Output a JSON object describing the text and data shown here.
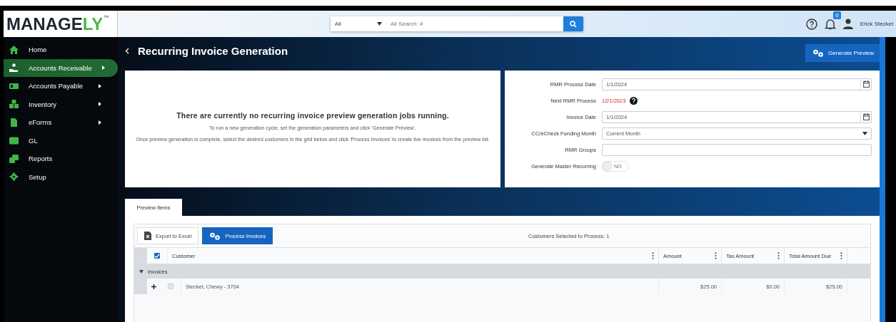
{
  "logo": {
    "text": "MANAGE",
    "accent": "LY",
    "mark": "™"
  },
  "search": {
    "scope": "All",
    "placeholder": "All Search: #"
  },
  "header": {
    "notifications": "0",
    "user": "Erick Steckel"
  },
  "sidebar": {
    "items": [
      {
        "label": "Home",
        "selected": false,
        "submenu": false
      },
      {
        "label": "Accounts Receivable",
        "selected": true,
        "submenu": true
      },
      {
        "label": "Accounts Payable",
        "selected": false,
        "submenu": true
      },
      {
        "label": "Inventory",
        "selected": false,
        "submenu": true
      },
      {
        "label": "eForms",
        "selected": false,
        "submenu": true
      },
      {
        "label": "GL",
        "selected": false,
        "submenu": false
      },
      {
        "label": "Reports",
        "selected": false,
        "submenu": false
      },
      {
        "label": "Setup",
        "selected": false,
        "submenu": false
      }
    ]
  },
  "page": {
    "title": "Recurring Invoice Generation",
    "action": "Generate Preview"
  },
  "info": {
    "heading": "There are currently no recurring invoice preview generation jobs running.",
    "paragraphs": [
      "To run a new generation cycle, set the generation parameters and click 'Generate Preview'.",
      "Once preview generation is complete, select the desired customers in the grid below and click 'Process Invoices' to create live invoices from the preview list."
    ]
  },
  "form": [
    {
      "label": "RMR Process Date",
      "kind": "date",
      "value": "1/1/2024"
    },
    {
      "label": "Next RMR Process",
      "kind": "readout",
      "value": "12/1/2023"
    },
    {
      "label": "Invoice Date",
      "kind": "date",
      "value": "1/1/2024"
    },
    {
      "label": "CC/eCheck Funding Month",
      "kind": "select",
      "value": "Current Month"
    },
    {
      "label": "RMR Groups",
      "kind": "text"
    },
    {
      "label": "Generate Master Recurring",
      "kind": "toggle",
      "on": false,
      "value": "NO"
    }
  ],
  "tabs": [
    {
      "label": "Preview Items",
      "selected": true
    }
  ],
  "grid": {
    "buttons": [
      {
        "label": "Export to Excel",
        "kind": "export"
      },
      {
        "label": "Process Invoices",
        "kind": "process"
      }
    ],
    "selection_label": "Customers Selected to Process:",
    "selection_count": "1",
    "select_all": true,
    "columns": [
      "Customer",
      "Amount",
      "Tax Amount",
      "Total Amount Due"
    ],
    "group": {
      "label": "Invoices",
      "expanded": true
    },
    "rows": [
      {
        "customer": "Steckel, Chewy - 3704",
        "amount": "$25.00",
        "tax": "$0.00",
        "total": "$25.00",
        "checked": false
      }
    ]
  }
}
